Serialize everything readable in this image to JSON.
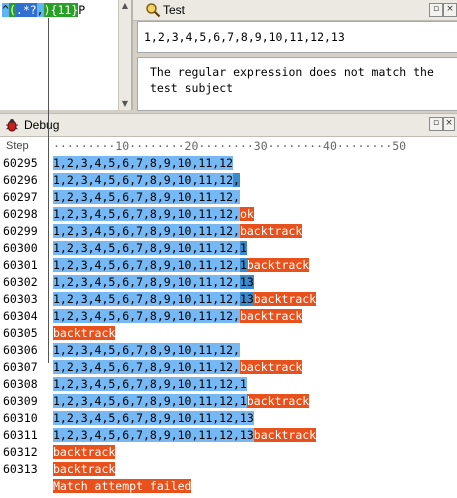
{
  "regex": {
    "tokens": [
      {
        "text": "^",
        "kind": "anchor"
      },
      {
        "text": "(",
        "kind": "group"
      },
      {
        "text": ".",
        "kind": "any"
      },
      {
        "text": "*?",
        "kind": "quant"
      },
      {
        "text": ",",
        "kind": "lit"
      },
      {
        "text": ")",
        "kind": "group"
      },
      {
        "text": "{11}",
        "kind": "rep"
      },
      {
        "text": "P",
        "kind": "plain"
      }
    ]
  },
  "test": {
    "title": "Test",
    "subject": "1,2,3,4,5,6,7,8,9,10,11,12,13",
    "result": "The regular expression does not match the test subject"
  },
  "debug": {
    "title": "Debug",
    "ruler_label": "Step",
    "ruler_ticks": "·········10········20········30········40········50",
    "steps": [
      {
        "n": "60295",
        "match": "1,2,3,4,5,6,7,8,9,10,11,12",
        "dark": "",
        "bt": ""
      },
      {
        "n": "60296",
        "match": "1,2,3,4,5,6,7,8,9,10,11,12",
        "dark": ",",
        "bt": ""
      },
      {
        "n": "60297",
        "match": "1,2,3,4,5,6,7,8,9,10,11,12,",
        "dark": "",
        "bt": ""
      },
      {
        "n": "60298",
        "match": "1,2,3,4,5,6,7,8,9,10,11,12,",
        "dark": "",
        "bt": "ok"
      },
      {
        "n": "60299",
        "match": "1,2,3,4,5,6,7,8,9,10,11,12,",
        "dark": "",
        "bt": "backtrack"
      },
      {
        "n": "60300",
        "match": "1,2,3,4,5,6,7,8,9,10,11,12,",
        "dark": "1",
        "bt": ""
      },
      {
        "n": "60301",
        "match": "1,2,3,4,5,6,7,8,9,10,11,12,",
        "dark": "1",
        "bt": "backtrack"
      },
      {
        "n": "60302",
        "match": "1,2,3,4,5,6,7,8,9,10,11,12,",
        "dark": "13",
        "bt": ""
      },
      {
        "n": "60303",
        "match": "1,2,3,4,5,6,7,8,9,10,11,12,",
        "dark": "13",
        "bt": "backtrack"
      },
      {
        "n": "60304",
        "match": "1,2,3,4,5,6,7,8,9,10,11,12,",
        "dark": "",
        "bt": "backtrack"
      },
      {
        "n": "60305",
        "match": "",
        "dark": "",
        "bt": "backtrack"
      },
      {
        "n": "60306",
        "match": "1,2,3,4,5,6,7,8,9,10,11,12,",
        "dark": "",
        "bt": ""
      },
      {
        "n": "60307",
        "match": "1,2,3,4,5,6,7,8,9,10,11,12,",
        "dark": "",
        "bt": "backtrack"
      },
      {
        "n": "60308",
        "match": "1,2,3,4,5,6,7,8,9,10,11,12,1",
        "dark": "",
        "bt": ""
      },
      {
        "n": "60309",
        "match": "1,2,3,4,5,6,7,8,9,10,11,12,1",
        "dark": "",
        "bt": "backtrack"
      },
      {
        "n": "60310",
        "match": "1,2,3,4,5,6,7,8,9,10,11,12,13",
        "dark": "",
        "bt": ""
      },
      {
        "n": "60311",
        "match": "1,2,3,4,5,6,7,8,9,10,11,12,13",
        "dark": "",
        "bt": "backtrack"
      },
      {
        "n": "60312",
        "match": "",
        "dark": "",
        "bt": "backtrack"
      },
      {
        "n": "60313",
        "match": "",
        "dark": "",
        "bt": "backtrack"
      },
      {
        "n": "",
        "match": "",
        "dark": "",
        "bt": "Match attempt failed"
      }
    ]
  },
  "colors": {
    "match": "#76b8f3",
    "match_dark": "#3b8acd",
    "backtrack": "#e8501c",
    "group": "#28a028"
  },
  "icons": {
    "test": "magnifier-icon",
    "debug": "bug-icon"
  }
}
